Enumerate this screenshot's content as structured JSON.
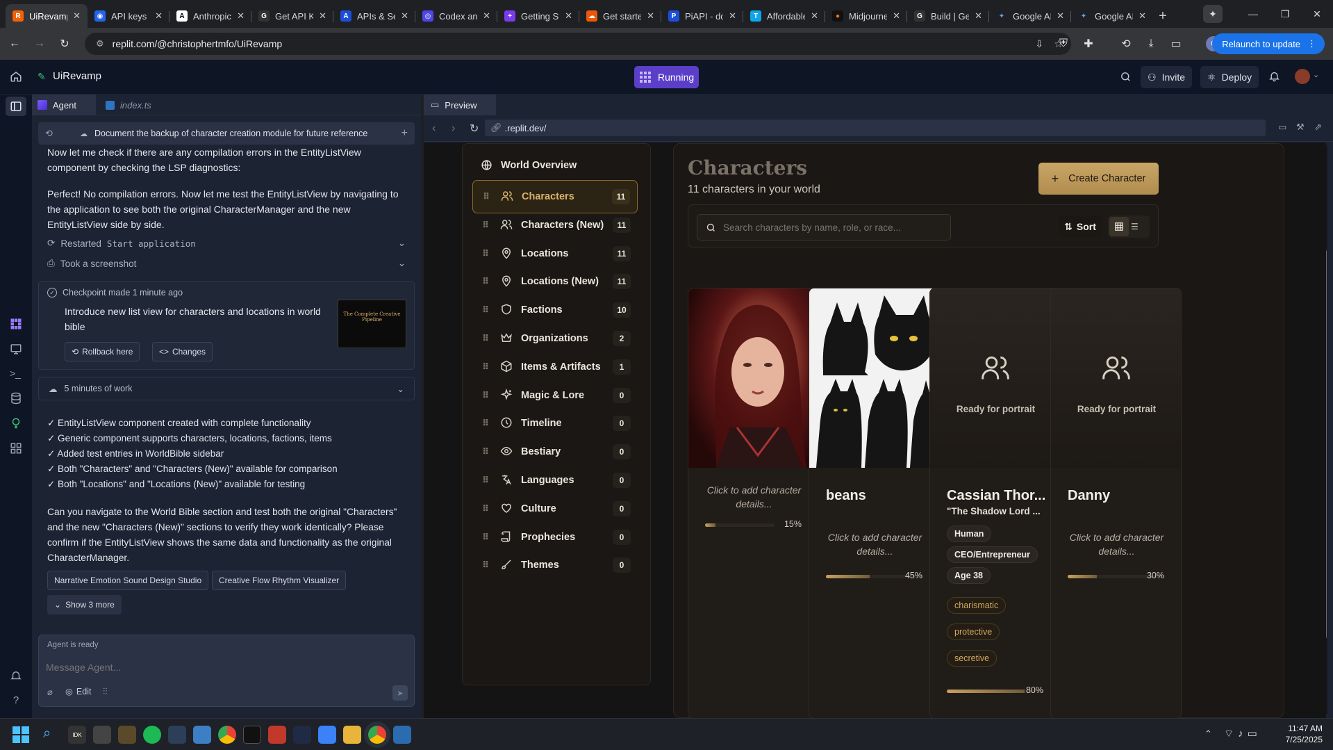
{
  "browser": {
    "tabs": [
      {
        "title": "UiRevamp",
        "color": "#f26207",
        "glyph": "R",
        "active": true
      },
      {
        "title": "API keys",
        "color": "#2563eb",
        "glyph": "◉"
      },
      {
        "title": "Anthropic",
        "color": "#000000",
        "glyph": "A"
      },
      {
        "title": "Get API Keys",
        "color": "#000000",
        "glyph": "G"
      },
      {
        "title": "APIs & Services",
        "color": "#1d4ed8",
        "glyph": "A"
      },
      {
        "title": "Codex and Agents",
        "color": "#4f46e5",
        "glyph": "◎"
      },
      {
        "title": "Getting Started",
        "color": "#7c3aed",
        "glyph": "+"
      },
      {
        "title": "Get started",
        "color": "#ea580c",
        "glyph": "☁"
      },
      {
        "title": "PiAPI - docs",
        "color": "#1d4ed8",
        "glyph": "P"
      },
      {
        "title": "Affordable AI",
        "color": "#0ea5e9",
        "glyph": "T"
      },
      {
        "title": "Midjourney",
        "color": "#111111",
        "glyph": "●"
      },
      {
        "title": "Build | Gemini",
        "color": "#111111",
        "glyph": "G"
      },
      {
        "title": "Google AI",
        "color": "#3b82f6",
        "glyph": "✦"
      },
      {
        "title": "Google AI",
        "color": "#3b82f6",
        "glyph": "✦"
      }
    ],
    "url": "replit.com/@christophertmfo/UiRevamp",
    "relaunch_label": "Relaunch to update",
    "profile_initial": "C"
  },
  "replit": {
    "project_name": "UiRevamp",
    "run_status": "Running",
    "invite_label": "Invite",
    "deploy_label": "Deploy"
  },
  "agent": {
    "tab_agent": "Agent",
    "tab_file": "index.ts",
    "history_banner": "Document the backup of character creation module for future reference",
    "msg1": "Now let me check if there are any compilation errors in the EntityListView component by checking the LSP diagnostics:",
    "msg2": "Perfect! No compilation errors. Now let me test the EntityListView by navigating to the application to see both the original CharacterManager and the new EntityListView side by side.",
    "restarted_prefix": "Restarted",
    "restarted_cmd": "Start application",
    "screenshot_label": "Took a screenshot",
    "checkpoint_label": "Checkpoint made 1 minute ago",
    "checkpoint_text": "Introduce new list view for characters and locations in world bible",
    "rollback_label": "Rollback here",
    "changes_label": "Changes",
    "thumb_title": "The Complete Creative Pipeline",
    "work_label": "5 minutes of work",
    "checklist": [
      "✓ EntityListView component created with complete functionality",
      "✓ Generic component supports characters, locations, factions, items",
      "✓ Added test entries in WorldBible sidebar",
      "✓ Both \"Characters\" and \"Characters (New)\" available for comparison",
      "✓ Both \"Locations\" and \"Locations (New)\" available for testing"
    ],
    "question": "Can you navigate to the World Bible section and test both the original \"Characters\" and the new \"Characters (New)\" sections to verify they work identically? Please confirm if the EntityListView shows the same data and functionality as the original CharacterManager.",
    "suggestions": [
      "Narrative Emotion Sound Design Studio",
      "Creative Flow Rhythm Visualizer"
    ],
    "show_more": "Show 3 more",
    "ready_label": "Agent is ready",
    "input_placeholder": "Message Agent...",
    "edit_label": "Edit"
  },
  "preview": {
    "tab_label": "Preview",
    "url": ".replit.dev/"
  },
  "world": {
    "sidebar_title": "World Overview",
    "items": [
      {
        "label": "Characters",
        "count": "11",
        "icon": "users-icon"
      },
      {
        "label": "Characters (New)",
        "count": "11",
        "icon": "users-icon"
      },
      {
        "label": "Locations",
        "count": "11",
        "icon": "map-pin-icon"
      },
      {
        "label": "Locations (New)",
        "count": "11",
        "icon": "map-pin-icon"
      },
      {
        "label": "Factions",
        "count": "10",
        "icon": "shield-icon"
      },
      {
        "label": "Organizations",
        "count": "2",
        "icon": "crown-icon"
      },
      {
        "label": "Items & Artifacts",
        "count": "1",
        "icon": "box-icon"
      },
      {
        "label": "Magic & Lore",
        "count": "0",
        "icon": "sparkles-icon"
      },
      {
        "label": "Timeline",
        "count": "0",
        "icon": "clock-icon"
      },
      {
        "label": "Bestiary",
        "count": "0",
        "icon": "eye-icon"
      },
      {
        "label": "Languages",
        "count": "0",
        "icon": "languages-icon"
      },
      {
        "label": "Culture",
        "count": "0",
        "icon": "heart-icon"
      },
      {
        "label": "Prophecies",
        "count": "0",
        "icon": "scroll-icon"
      },
      {
        "label": "Themes",
        "count": "0",
        "icon": "brush-icon"
      }
    ],
    "title": "Characters",
    "subtitle": "11 characters in your world",
    "create_label": "Create Character",
    "search_placeholder": "Search characters by name, role, or race...",
    "sort_label": "Sort",
    "cards": [
      {
        "name": "",
        "hint": "Click to add character details...",
        "progress": 0.15,
        "pct": "15%"
      },
      {
        "name": "beans",
        "hint": "Click to add character details...",
        "progress": 0.45,
        "pct": "45%"
      },
      {
        "name": "Cassian Thor...",
        "subtitle": "\"The Shadow Lord ...",
        "portrait": "Ready for portrait",
        "tags": [
          "Human",
          "CEO/Entrepreneur",
          "Age 38"
        ],
        "traits": [
          "charismatic",
          "protective",
          "secretive"
        ],
        "progress": 0.8,
        "pct": "80%"
      },
      {
        "name": "Danny",
        "portrait": "Ready for portrait",
        "hint": "Click to add character details...",
        "progress": 0.3,
        "pct": "30%"
      }
    ]
  },
  "taskbar": {
    "time": "11:47 AM",
    "date": "7/25/2025"
  }
}
